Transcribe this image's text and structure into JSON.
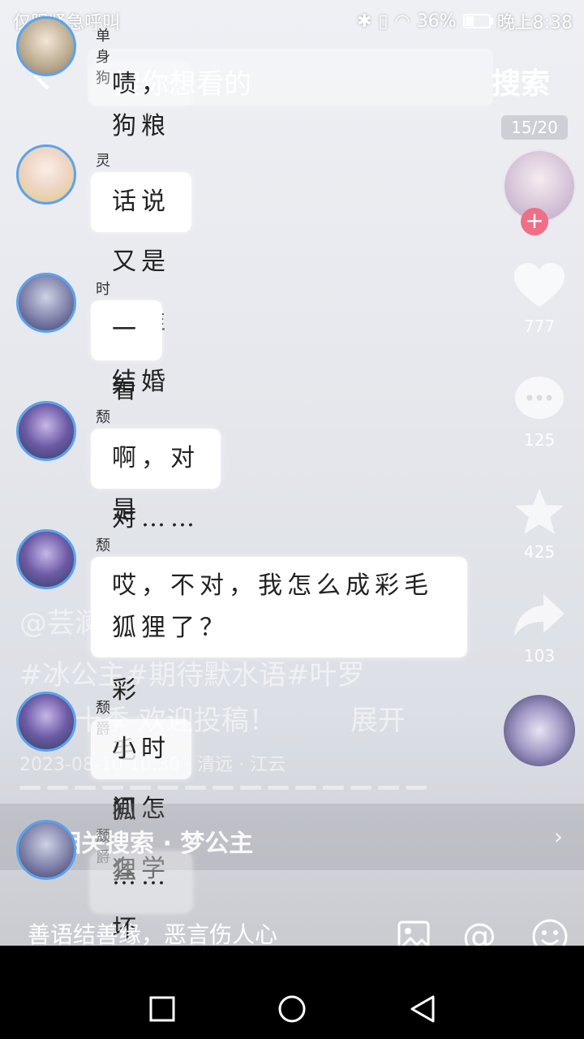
{
  "status": {
    "carrier": "仅限紧急呼叫",
    "battery": "36%",
    "battery_level": 0.36,
    "time": "晚上8:38"
  },
  "search": {
    "placeholder": "搜你想看的",
    "button": "搜索"
  },
  "page_indicator": "15/20",
  "messages": [
    {
      "name": "单身狗",
      "text": "啧，狗粮"
    },
    {
      "name": "灵公主",
      "text": "话说又是和谁结婚呢？"
    },
    {
      "name": "时希",
      "text": "一看就是那个彩毛狐狸"
    },
    {
      "name": "颓爵",
      "text": "啊，对对……"
    },
    {
      "name": "颓爵",
      "text": "哎，不对，我怎么成彩毛狐狸了？"
    },
    {
      "name": "颓爵",
      "text": "小时间怎么学坏了？"
    },
    {
      "name": "颓爵",
      "text": "……"
    }
  ],
  "sidebar": {
    "likes": "777",
    "comments": "125",
    "favorites": "425",
    "shares": "103"
  },
  "overlay": {
    "author": "@芸澜·(不洁版)",
    "tags": "#冰公主#期待默水语#叶罗",
    "line3": "丽第十季  欢迎投稿！",
    "expand": "展开",
    "date": "2023-08-10 10:30 · 清远 · 江云"
  },
  "related": {
    "label": "相关搜索 · 梦公主"
  },
  "comment_placeholder": "善语结善缘，恶言伤人心",
  "icons": [
    "back-icon",
    "heart-icon",
    "comment-icon",
    "star-icon",
    "share-icon",
    "image-icon",
    "at-icon",
    "emoji-icon",
    "nav-recent-icon",
    "nav-home-icon",
    "nav-back-icon"
  ]
}
